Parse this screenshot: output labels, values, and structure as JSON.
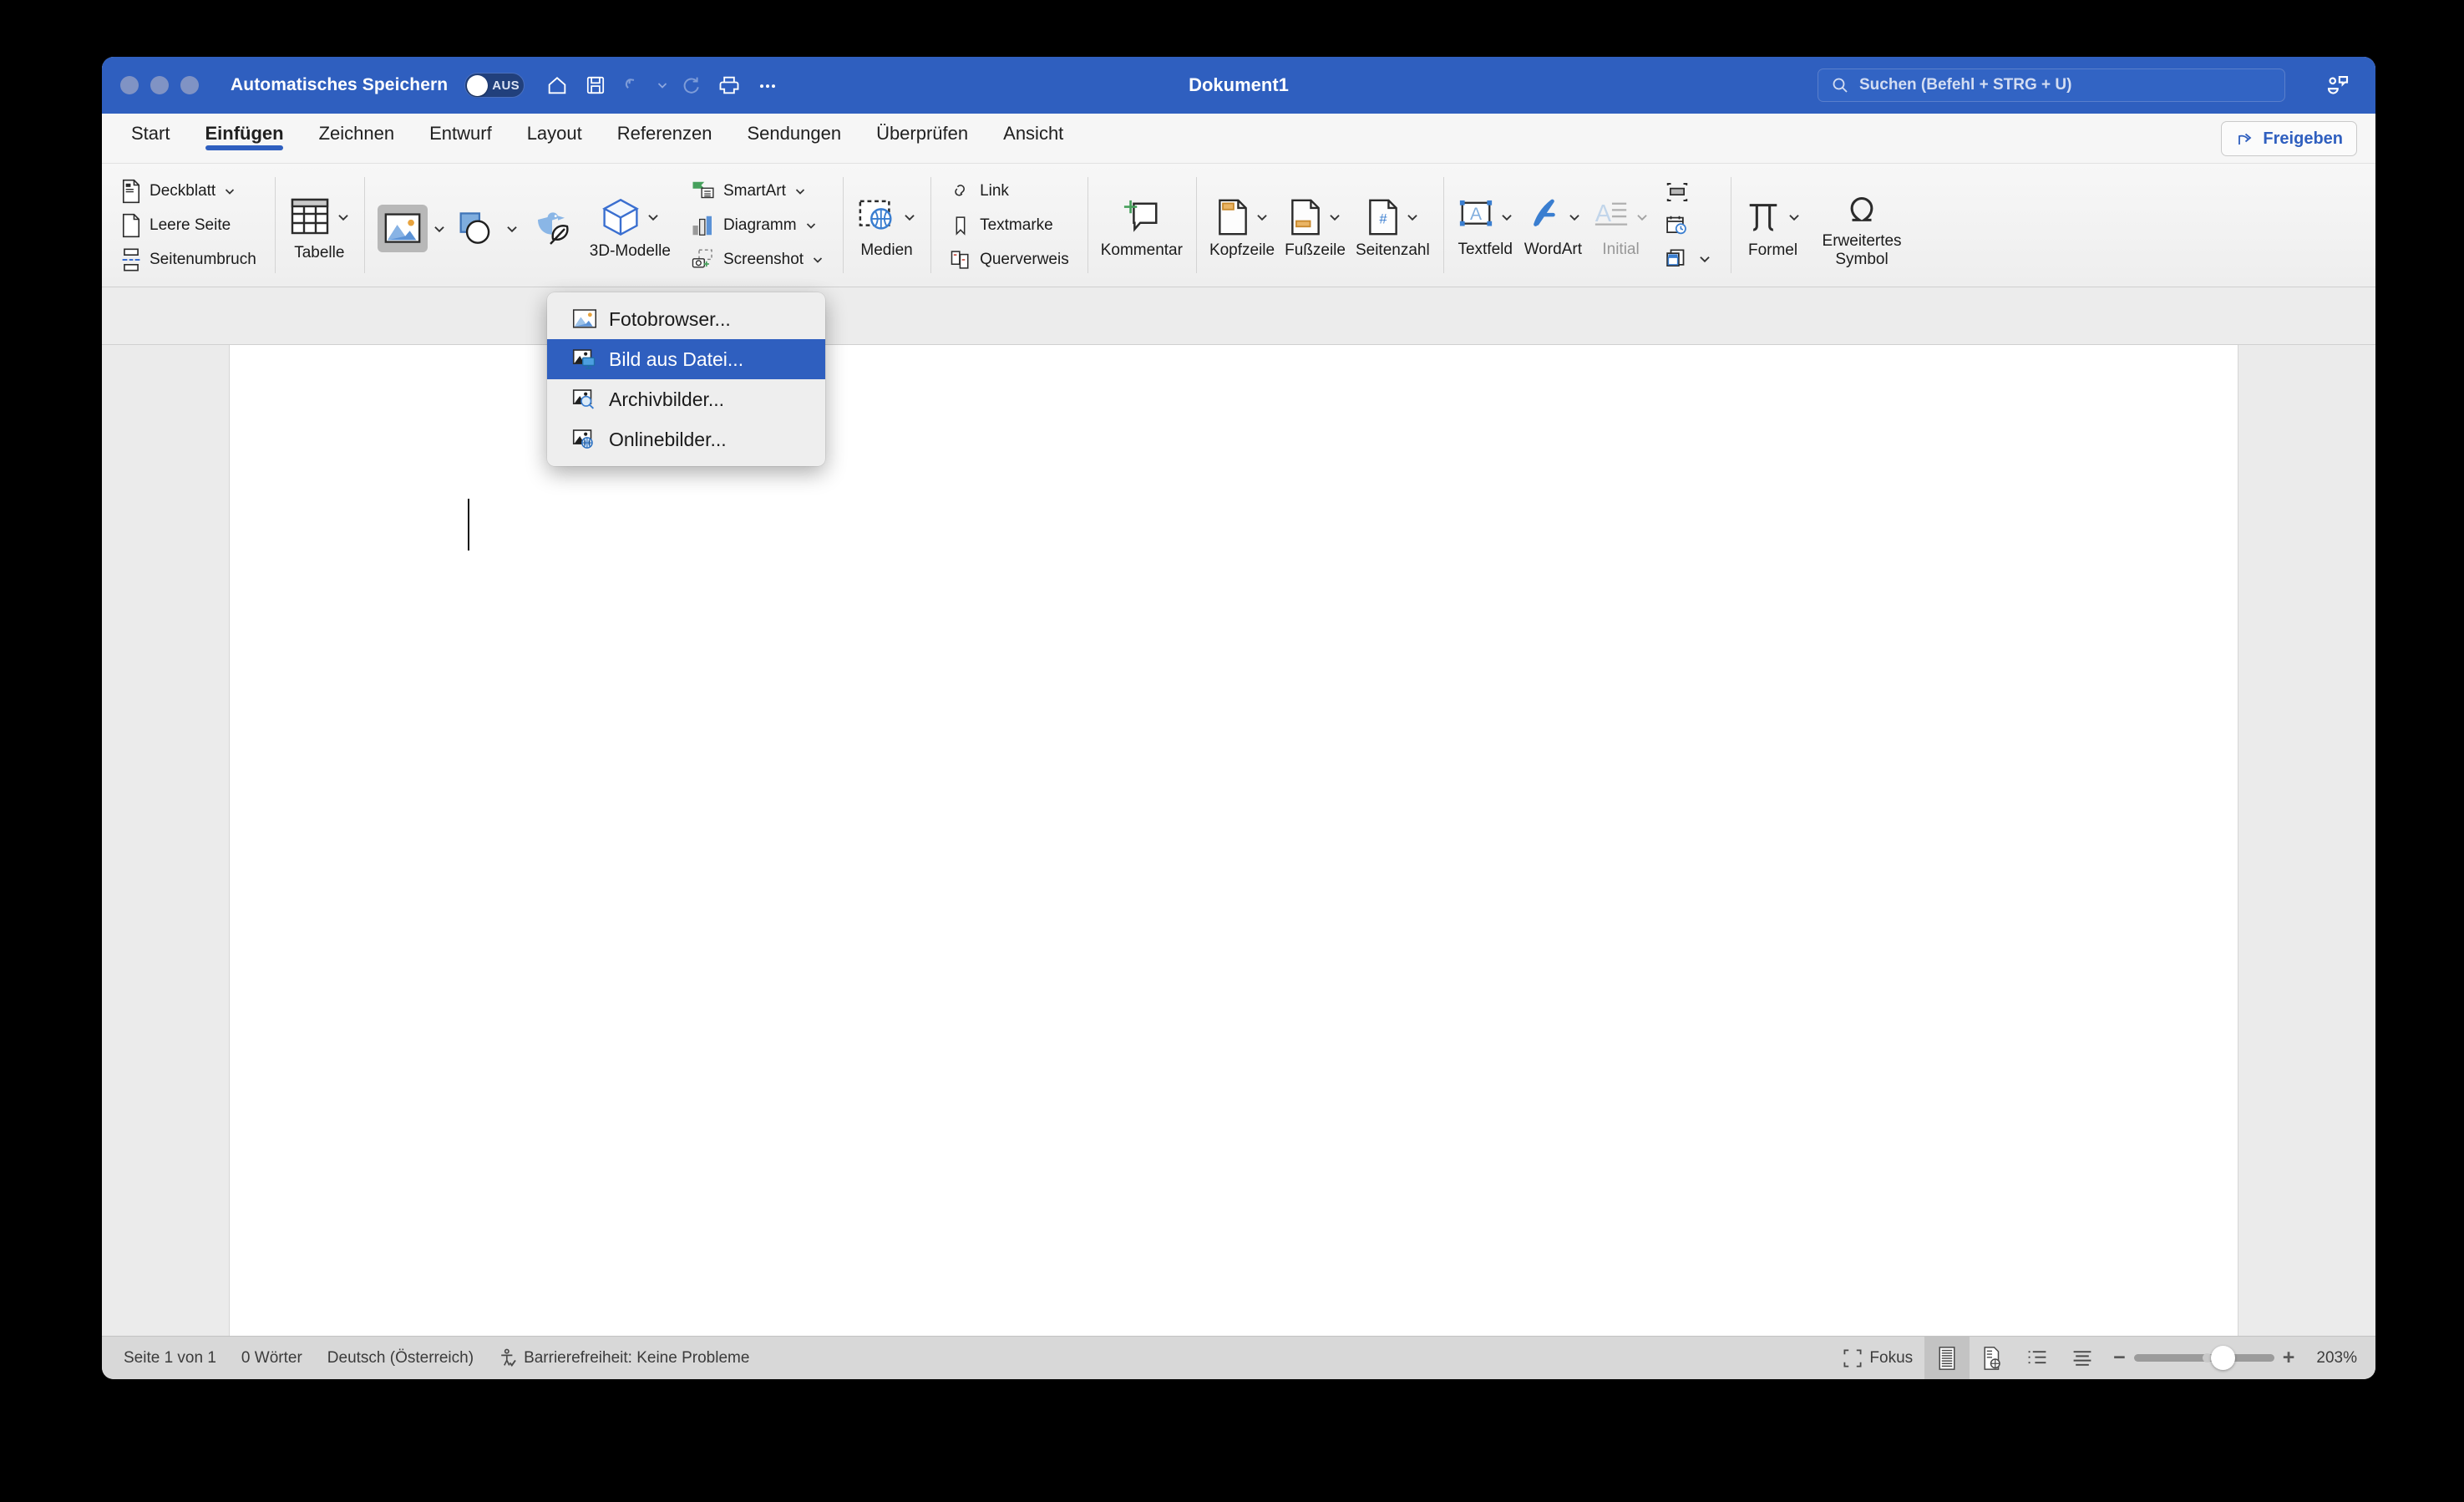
{
  "titlebar": {
    "autosave_label": "Automatisches Speichern",
    "autosave_state": "AUS",
    "document_title": "Dokument1",
    "search_placeholder": "Suchen (Befehl + STRG + U)",
    "quick_access": [
      "home-icon",
      "save-icon",
      "undo-icon",
      "redo-icon",
      "print-icon",
      "more-icon"
    ],
    "accent_color": "#2f5fbf"
  },
  "tabs": [
    {
      "label": "Start",
      "active": false
    },
    {
      "label": "Einfügen",
      "active": true
    },
    {
      "label": "Zeichnen",
      "active": false
    },
    {
      "label": "Entwurf",
      "active": false
    },
    {
      "label": "Layout",
      "active": false
    },
    {
      "label": "Referenzen",
      "active": false
    },
    {
      "label": "Sendungen",
      "active": false
    },
    {
      "label": "Überprüfen",
      "active": false
    },
    {
      "label": "Ansicht",
      "active": false
    }
  ],
  "share": {
    "label": "Freigeben",
    "icon": "share-icon"
  },
  "ribbon": {
    "pages": [
      {
        "label": "Deckblatt",
        "icon": "cover-page-icon",
        "caret": true
      },
      {
        "label": "Leere Seite",
        "icon": "blank-page-icon",
        "caret": false
      },
      {
        "label": "Seitenumbruch",
        "icon": "page-break-icon",
        "caret": false
      }
    ],
    "table": {
      "label": "Tabelle",
      "icon": "table-icon",
      "caret": true
    },
    "illustrations": [
      {
        "label": "Bilder",
        "icon": "pictures-icon",
        "caret": true,
        "pressed": true
      },
      {
        "label": "Formen",
        "icon": "shapes-icon",
        "caret": true
      },
      {
        "label": "Symbole",
        "icon": "icons-icon",
        "caret": false
      },
      {
        "label": "3D-Modelle",
        "icon": "3d-model-icon",
        "caret": true
      }
    ],
    "graphics": [
      {
        "label": "SmartArt",
        "icon": "smartart-icon",
        "caret": true
      },
      {
        "label": "Diagramm",
        "icon": "chart-icon",
        "caret": true
      },
      {
        "label": "Screenshot",
        "icon": "screenshot-icon",
        "caret": true
      }
    ],
    "media": {
      "label": "Medien",
      "icon": "media-icon",
      "caret": true
    },
    "links": [
      {
        "label": "Link",
        "icon": "link-icon"
      },
      {
        "label": "Textmarke",
        "icon": "bookmark-icon"
      },
      {
        "label": "Querverweis",
        "icon": "cross-reference-icon"
      }
    ],
    "comment": {
      "label": "Kommentar",
      "icon": "new-comment-icon"
    },
    "header_footer": [
      {
        "label": "Kopfzeile",
        "icon": "header-icon",
        "caret": true
      },
      {
        "label": "Fußzeile",
        "icon": "footer-icon",
        "caret": true
      },
      {
        "label": "Seitenzahl",
        "icon": "page-number-icon",
        "caret": true
      }
    ],
    "text": [
      {
        "label": "Textfeld",
        "icon": "text-box-icon",
        "caret": true
      },
      {
        "label": "WordArt",
        "icon": "wordart-icon",
        "caret": true
      },
      {
        "label": "Initial",
        "icon": "drop-cap-icon",
        "caret": true,
        "disabled": true
      }
    ],
    "text_small": [
      {
        "icon": "field-icon",
        "caret": false
      },
      {
        "icon": "date-time-icon",
        "caret": false
      },
      {
        "icon": "object-icon",
        "caret": true
      }
    ],
    "symbols": [
      {
        "label": "Formel",
        "icon": "equation-icon",
        "caret": true
      },
      {
        "label": "Erweitertes Symbol",
        "icon": "symbol-icon",
        "caret": false
      }
    ]
  },
  "menu": {
    "items": [
      {
        "label": "Fotobrowser...",
        "icon": "photo-browser-icon",
        "selected": false
      },
      {
        "label": "Bild aus Datei...",
        "icon": "picture-from-file-icon",
        "selected": true
      },
      {
        "label": "Archivbilder...",
        "icon": "stock-images-icon",
        "selected": false
      },
      {
        "label": "Onlinebilder...",
        "icon": "online-pictures-icon",
        "selected": false
      }
    ],
    "highlight_color": "#2f5fbf"
  },
  "status": {
    "page": "Seite 1 von 1",
    "words": "0 Wörter",
    "language": "Deutsch (Österreich)",
    "accessibility": "Barrierefreiheit: Keine Probleme",
    "focus": "Fokus",
    "views": [
      "print-layout-icon",
      "web-layout-icon",
      "outline-icon",
      "draft-icon"
    ],
    "zoom_out": "−",
    "zoom_in": "+",
    "zoom_level": "203%"
  }
}
